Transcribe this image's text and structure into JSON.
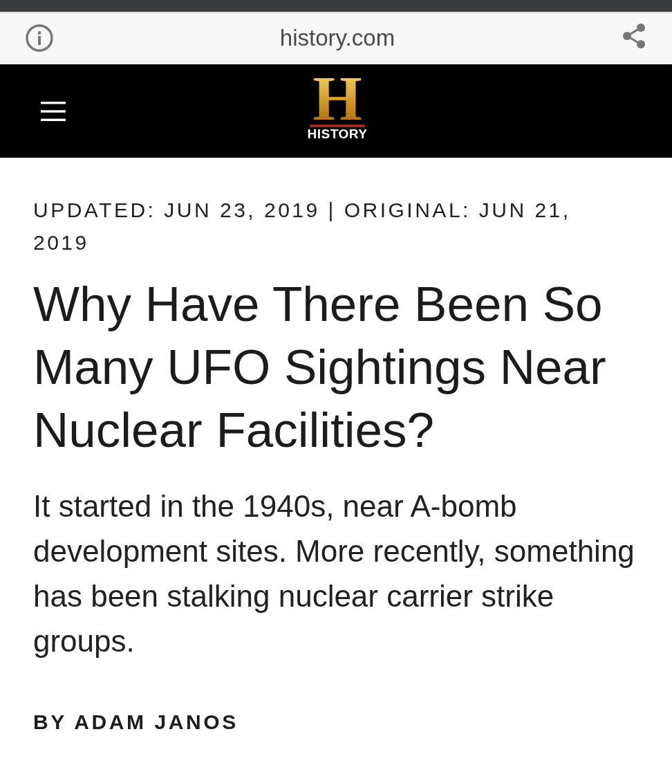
{
  "address_bar": {
    "url": "history.com"
  },
  "header": {
    "logo_letter": "H",
    "logo_text": "HISTORY"
  },
  "article": {
    "dateline": "UPDATED: JUN 23, 2019 | ORIGINAL: JUN 21, 2019",
    "title": "Why Have There Been So Many UFO Sightings Near Nuclear Facilities?",
    "dek": "It started in the 1940s, near A-bomb development sites. More recently, something has been stalking nuclear carrier strike groups.",
    "byline": "BY ADAM JANOS"
  }
}
